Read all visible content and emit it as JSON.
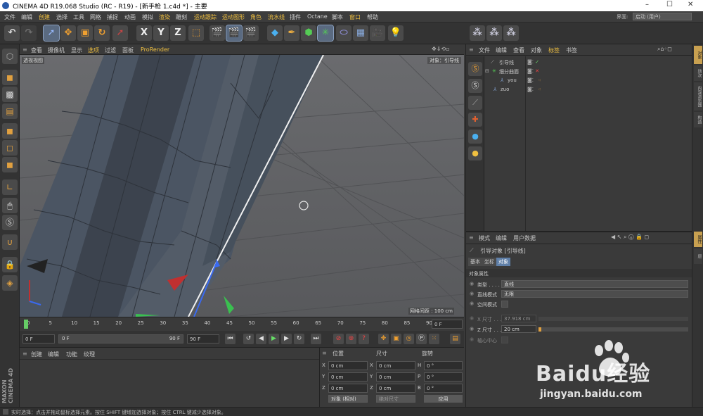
{
  "window": {
    "title": "CINEMA 4D R19.068 Studio (RC - R19) - [新手枪 1.c4d *] - 主要",
    "minimize": "–",
    "maximize": "☐",
    "close": "✕"
  },
  "menubar": {
    "items": [
      "文件",
      "编辑",
      "创建",
      "选择",
      "工具",
      "网格",
      "捕捉",
      "动画",
      "模拟",
      "渲染",
      "雕刻",
      "运动跟踪",
      "运动图形",
      "角色",
      "流水线",
      "插件",
      "Octane",
      "脚本",
      "窗口",
      "帮助"
    ],
    "interface_label": "界面:",
    "interface_value": "启动 (用户)"
  },
  "toolbar": {
    "axis_x": "X",
    "axis_y": "Y",
    "axis_z": "Z"
  },
  "viewport": {
    "menu": [
      "查看",
      "摄像机",
      "显示",
      "选项",
      "过滤",
      "面板",
      "ProRender"
    ],
    "label": "透视视图",
    "object_label": "对象：引导线",
    "grid_label": "网格间距 : 100 cm"
  },
  "timeline": {
    "ticks": [
      "0",
      "5",
      "10",
      "15",
      "20",
      "25",
      "30",
      "35",
      "40",
      "45",
      "50",
      "55",
      "60",
      "65",
      "70",
      "75",
      "80",
      "85",
      "90"
    ],
    "end_field": "0 F",
    "current_frame": 0,
    "max_frame": 90
  },
  "playbar": {
    "start": "0 F",
    "range_start": "0 F",
    "range_end": "90 F",
    "end": "90 F"
  },
  "material_manager": {
    "menu": [
      "创建",
      "编辑",
      "功能",
      "纹理"
    ]
  },
  "coord_manager": {
    "headers": [
      "位置",
      "尺寸",
      "旋转"
    ],
    "rows": [
      {
        "axis": "X",
        "pos": "0 cm",
        "size_axis": "X",
        "size": "0 cm",
        "rot_axis": "H",
        "rot": "0 °"
      },
      {
        "axis": "Y",
        "pos": "0 cm",
        "size_axis": "Y",
        "size": "0 cm",
        "rot_axis": "P",
        "rot": "0 °"
      },
      {
        "axis": "Z",
        "pos": "0 cm",
        "size_axis": "Z",
        "size": "0 cm",
        "rot_axis": "B",
        "rot": "0 °"
      }
    ],
    "mode": "对象 (相对)",
    "size_mode": "绝对尺寸",
    "apply": "应用"
  },
  "object_manager": {
    "menu": [
      "文件",
      "编辑",
      "查看",
      "对象",
      "标签",
      "书签"
    ],
    "objects": [
      {
        "name": "引导线",
        "color": "#f0c040"
      },
      {
        "name": "细分曲面",
        "color": "#c8c8c8"
      },
      {
        "name": "you",
        "color": "#c8c8c8"
      },
      {
        "name": "zuo",
        "color": "#c8c8c8"
      }
    ]
  },
  "attribute_manager": {
    "menu": [
      "模式",
      "编辑",
      "用户数据"
    ],
    "title": "引导对象 [引导线]",
    "tabs": [
      "基本",
      "坐标",
      "对象"
    ],
    "section": "对象属性",
    "type_label": "类型 . . . . . . .",
    "type_value": "直线",
    "straight_label": "直线模式",
    "straight_value": "无限",
    "space_label": "空间模式",
    "xsize_label": "X 尺寸 . . .",
    "xsize_value": "37.918 cm",
    "zsize_label": "Z 尺寸 . . .",
    "zsize_value": "20 cm",
    "center_label": "轴心中心"
  },
  "right_tabs": [
    "对象",
    "场次",
    "内容浏览器",
    "构造",
    "属性",
    "层"
  ],
  "status": "实时选择：点击并拖动鼠标选择元素。按住 SHIFT 键增加选择对象；按住 CTRL 键减少选择对象。",
  "logo": {
    "maxon": "MAXON",
    "c4d": "CINEMA 4D"
  },
  "watermark": {
    "brand": "Baidu经验",
    "url": "jingyan.baidu.com"
  }
}
